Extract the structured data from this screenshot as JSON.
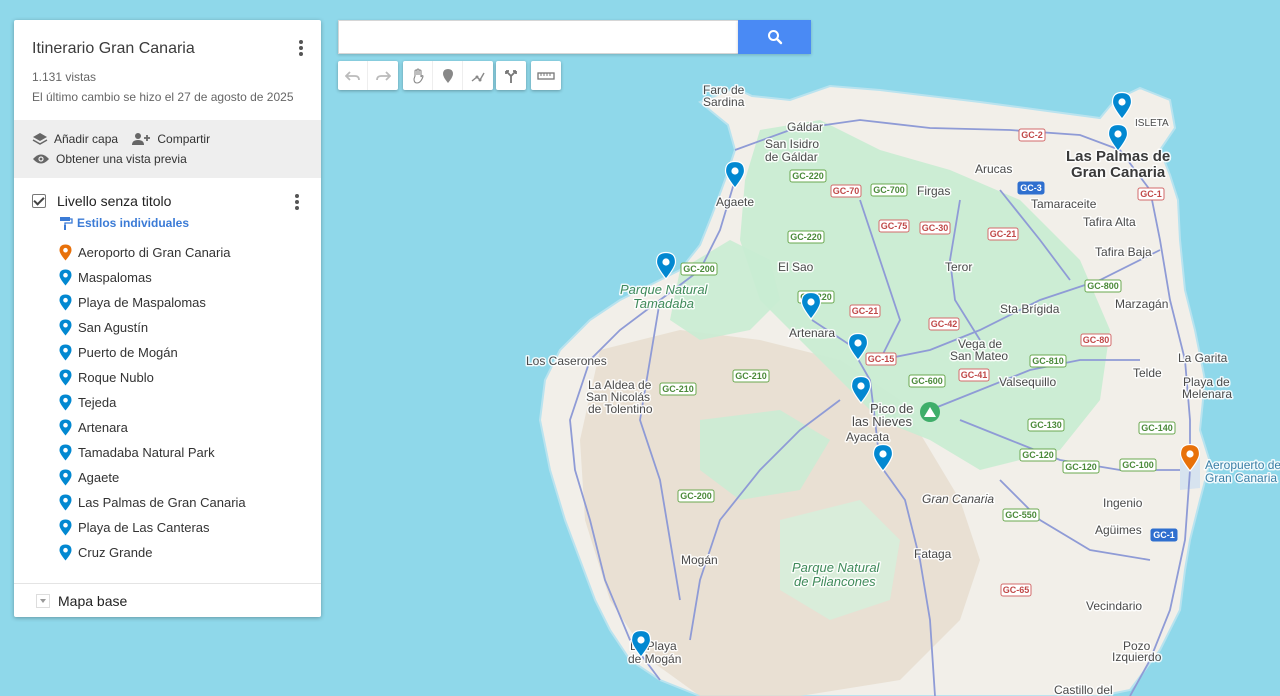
{
  "panel": {
    "title": "Itinerario Gran Canaria",
    "views": "1.131 vistas",
    "last_changed": "El último cambio se hizo el 27 de agosto de 2025",
    "actions": {
      "add_layer": "Añadir capa",
      "share": "Compartir",
      "preview": "Obtener una vista previa"
    },
    "layer": {
      "name": "Livello senza titolo",
      "styles_link": "Estilos individuales",
      "places": [
        {
          "label": "Aeroporto di Gran Canaria",
          "color": "#e8710a"
        },
        {
          "label": "Maspalomas",
          "color": "#0288d1"
        },
        {
          "label": "Playa de Maspalomas",
          "color": "#0288d1"
        },
        {
          "label": "San Agustín",
          "color": "#0288d1"
        },
        {
          "label": "Puerto de Mogán",
          "color": "#0288d1"
        },
        {
          "label": "Roque Nublo",
          "color": "#0288d1"
        },
        {
          "label": "Tejeda",
          "color": "#0288d1"
        },
        {
          "label": "Artenara",
          "color": "#0288d1"
        },
        {
          "label": "Tamadaba Natural Park",
          "color": "#0288d1"
        },
        {
          "label": "Agaete",
          "color": "#0288d1"
        },
        {
          "label": "Las Palmas de Gran Canaria",
          "color": "#0288d1"
        },
        {
          "label": "Playa de Las Canteras",
          "color": "#0288d1"
        },
        {
          "label": "Cruz Grande",
          "color": "#0288d1"
        }
      ]
    },
    "base_map": "Mapa base"
  },
  "search": {
    "value": ""
  },
  "colors": {
    "sea": "#8fd8ea",
    "land": "#f2efe9",
    "park": "#c9ecd3",
    "mountain": "#e6dccd",
    "road": "#8f9bd6",
    "pin_blue": "#0288d1",
    "pin_orange": "#e8710a",
    "search_button": "#4a8af4"
  },
  "map": {
    "labels": {
      "faro": "Faro de",
      "sardina": "Sardina",
      "galdar": "Gáldar",
      "san_isidro": "San Isidro",
      "de_galdar": "de Gáldar",
      "agaete": "Agaete",
      "firgas": "Firgas",
      "arucas": "Arucas",
      "tamaraceite": "Tamaraceite",
      "tafira_alta": "Tafira Alta",
      "tafira_baja": "Tafira Baja",
      "las_palmas_1": "Las Palmas de",
      "las_palmas_2": "Gran Canaria",
      "isleta": "ISLETA",
      "parque_tamadaba_1": "Parque Natural",
      "parque_tamadaba_2": "Tamadaba",
      "el_sao": "El Sao",
      "teror": "Teror",
      "artenara": "Artenara",
      "los_caserones": "Los Caserones",
      "la_aldea_1": "La Aldea de",
      "la_aldea_2": "San Nicolás",
      "la_aldea_3": "de Tolentino",
      "sta_brigida": "Sta Brígida",
      "vega_1": "Vega de",
      "vega_2": "San Mateo",
      "valsequillo": "Valsequillo",
      "marzagan": "Marzagán",
      "la_garita": "La Garita",
      "telde": "Telde",
      "playa_melenara_1": "Playa de",
      "playa_melenara_2": "Melenara",
      "pico_1": "Pico de",
      "pico_2": "las Nieves",
      "ayacata": "Ayacata",
      "gran_canaria": "Gran Canaria",
      "ingenio": "Ingenio",
      "aguimes": "Agüimes",
      "aeropuerto_1": "Aeropuerto de",
      "aeropuerto_2": "Gran Canaria",
      "mogan": "Mogán",
      "fataga": "Fataga",
      "pilancones_1": "Parque Natural",
      "pilancones_2": "de Pilancones",
      "vecindario": "Vecindario",
      "pozo_1": "Pozo",
      "pozo_2": "Izquierdo",
      "playa_mogan_1": "La Playa",
      "playa_mogan_2": "de Mogán",
      "castillo": "Castillo del"
    },
    "road_shields": [
      {
        "label": "GC-220",
        "kind": "green"
      },
      {
        "label": "GC-70",
        "kind": "red"
      },
      {
        "label": "GC-700",
        "kind": "green"
      },
      {
        "label": "GC-2",
        "kind": "red"
      },
      {
        "label": "GC-3",
        "kind": "blue"
      },
      {
        "label": "GC-1",
        "kind": "red"
      },
      {
        "label": "GC-220",
        "kind": "green"
      },
      {
        "label": "GC-75",
        "kind": "red"
      },
      {
        "label": "GC-30",
        "kind": "red"
      },
      {
        "label": "GC-21",
        "kind": "red"
      },
      {
        "label": "GC-200",
        "kind": "green"
      },
      {
        "label": "GC-220",
        "kind": "green"
      },
      {
        "label": "GC-800",
        "kind": "green"
      },
      {
        "label": "GC-21",
        "kind": "red"
      },
      {
        "label": "GC-42",
        "kind": "red"
      },
      {
        "label": "GC-80",
        "kind": "red"
      },
      {
        "label": "GC-15",
        "kind": "red"
      },
      {
        "label": "GC-810",
        "kind": "green"
      },
      {
        "label": "GC-210",
        "kind": "green"
      },
      {
        "label": "GC-210",
        "kind": "green"
      },
      {
        "label": "GC-600",
        "kind": "green"
      },
      {
        "label": "GC-41",
        "kind": "red"
      },
      {
        "label": "GC-130",
        "kind": "green"
      },
      {
        "label": "GC-140",
        "kind": "green"
      },
      {
        "label": "GC-120",
        "kind": "green"
      },
      {
        "label": "GC-120",
        "kind": "green"
      },
      {
        "label": "GC-100",
        "kind": "green"
      },
      {
        "label": "GC-200",
        "kind": "green"
      },
      {
        "label": "GC-550",
        "kind": "green"
      },
      {
        "label": "GC-1",
        "kind": "blue"
      },
      {
        "label": "GC-65",
        "kind": "red"
      }
    ]
  }
}
